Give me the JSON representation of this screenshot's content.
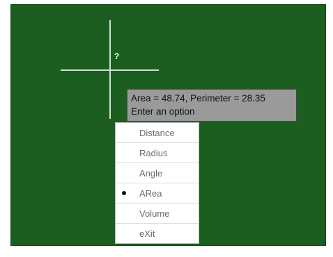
{
  "status": {
    "line1": "Area = 48.74, Perimeter = 28.35",
    "line2": "Enter an option"
  },
  "cursor": {
    "glyph": "?"
  },
  "menu": {
    "items": [
      {
        "label": "Distance",
        "selected": false
      },
      {
        "label": "Radius",
        "selected": false
      },
      {
        "label": "Angle",
        "selected": false
      },
      {
        "label": "ARea",
        "selected": true
      },
      {
        "label": "Volume",
        "selected": false
      },
      {
        "label": "eXit",
        "selected": false
      }
    ]
  },
  "colors": {
    "canvas_background": "#1b5e20",
    "crosshair": "#d7dcd7",
    "tooltip_background": "#9a9a9a"
  }
}
